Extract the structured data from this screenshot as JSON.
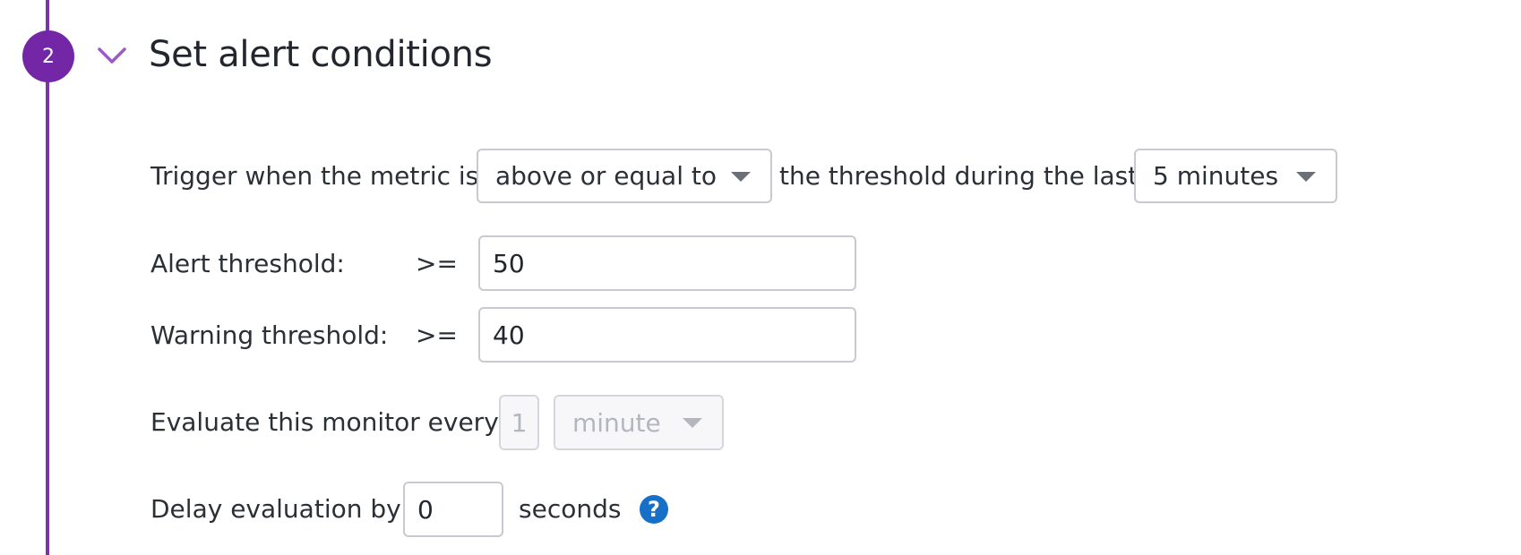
{
  "section": {
    "step_number": "2",
    "title": "Set alert conditions"
  },
  "trigger": {
    "prefix": "Trigger when the metric is",
    "comparison_value": "above or equal to",
    "middle": "the threshold during the last",
    "window_value": "5 minutes"
  },
  "alert_threshold": {
    "label": "Alert threshold:",
    "operator": ">=",
    "value": "50"
  },
  "warning_threshold": {
    "label": "Warning threshold:",
    "operator": ">=",
    "value": "40"
  },
  "evaluate": {
    "label": "Evaluate this monitor every",
    "count_value": "1",
    "unit_value": "minute"
  },
  "delay": {
    "label": "Delay evaluation by",
    "value": "0",
    "unit": "seconds",
    "help_glyph": "?"
  },
  "icons": {
    "collapse": "chevron-down-icon",
    "help": "question-circle-icon",
    "dropdown": "caret-down-icon"
  },
  "colors": {
    "accent": "#7326a6",
    "timeline": "#7b35a8",
    "help": "#1670c8"
  }
}
